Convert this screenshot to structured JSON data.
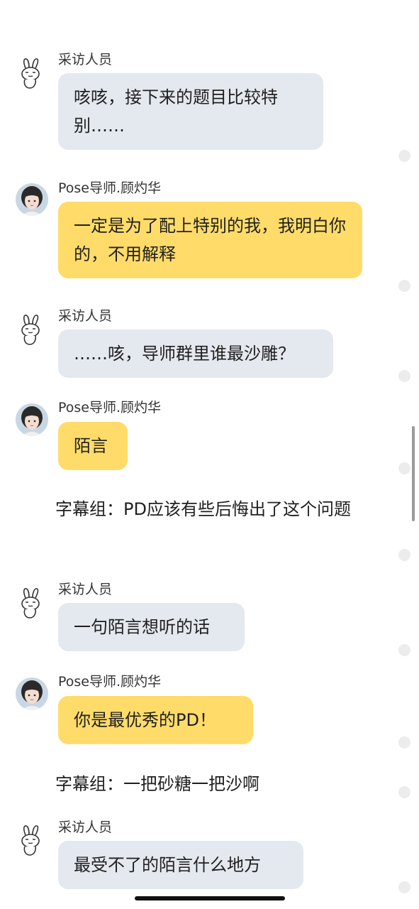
{
  "senders": {
    "interviewer": "采访人员",
    "mentor": "Pose导师.顾灼华"
  },
  "messages": [
    {
      "sender": "采访人员",
      "text": "咳咳，接下来的题目比较特别……"
    },
    {
      "sender": "Pose导师.顾灼华",
      "text": "一定是为了配上特别的我，我明白你的，不用解释"
    },
    {
      "sender": "采访人员",
      "text": "……咳，导师群里谁最沙雕？"
    },
    {
      "sender": "Pose导师.顾灼华",
      "text": "陌言"
    },
    {
      "sender": "采访人员",
      "text": "一句陌言想听的话"
    },
    {
      "sender": "Pose导师.顾灼华",
      "text": "你是最优秀的PD！"
    },
    {
      "sender": "采访人员",
      "text": "最受不了的陌言什么地方"
    }
  ],
  "narrations": [
    "字幕组：PD应该有些后悔出了这个问题",
    "字幕组：一把砂糖一把沙啊"
  ],
  "icons": {
    "interviewer_avatar": "rabbit-doodle-icon",
    "mentor_avatar": "girl-portrait-icon"
  },
  "colors": {
    "interviewer_bubble": "#e3e9ef",
    "mentor_bubble": "#ffdc6a",
    "background": "#ffffff"
  }
}
